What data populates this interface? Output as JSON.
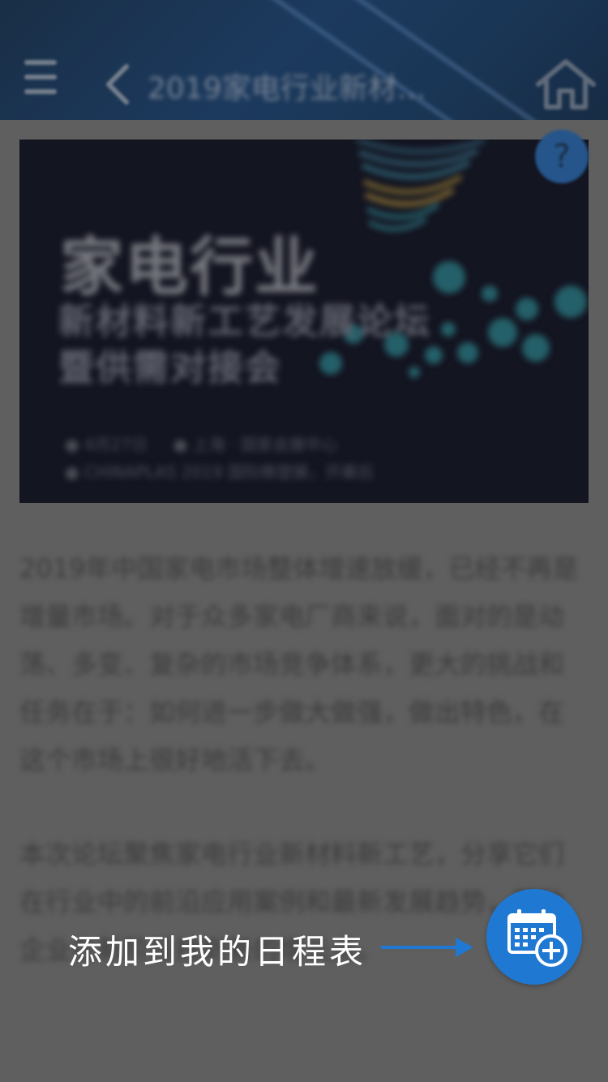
{
  "header": {
    "title": "2019家电行业新材…",
    "menu_icon": "menu-icon",
    "back_icon": "chevron-left-icon",
    "home_icon": "home-icon"
  },
  "banner": {
    "title_line1": "家电行业",
    "title_line2": "新材料新工艺发展论坛",
    "title_line3": "暨供需对接会",
    "info_date": "4月27日",
    "info_place": "上海 · 国家会展中心",
    "info_event": "CHINAPLAS 2019 国际橡塑展，开幕后",
    "help_label": "?"
  },
  "article": {
    "paragraph1": "2019年中国家电市场整体增速放缓，已经不再是增量市场。对于众多家电厂商来说，面对的是动荡、多变、复杂的市场竞争体系，更大的挑战和任务在于：如何进一步做大做强，做出特色，在这个市场上很好地活下去。",
    "paragraph2": "本次论坛聚焦家电行业新材料新工艺，分享它们在行业中的前沿应用案例和最新发展趋势，帮助企业在新阶段找到新的增长点。"
  },
  "tip": {
    "text": "添加到我的日程表",
    "button_icon": "calendar-add-icon"
  },
  "colors": {
    "fab": "#1f78d1",
    "header": "#123a6a",
    "banner": "#060818"
  }
}
